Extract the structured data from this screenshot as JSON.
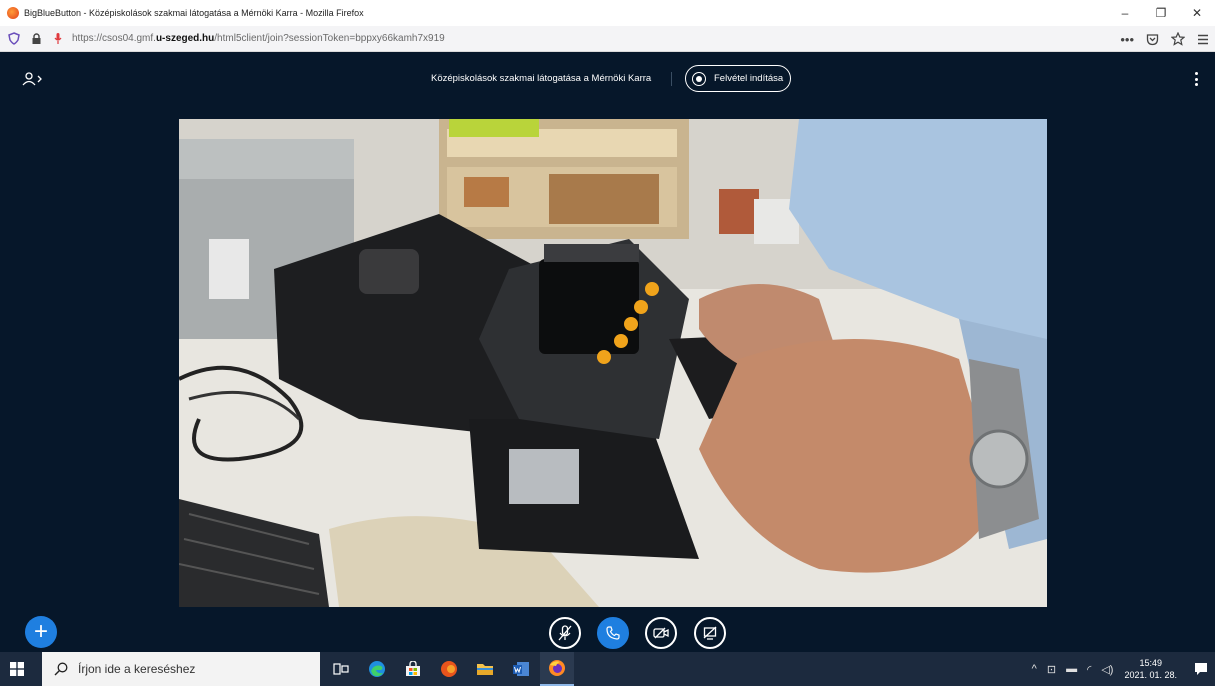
{
  "window": {
    "title": "BigBlueButton - Középiskolások szakmai látogatása a Mérnöki Karra - Mozilla Firefox",
    "controls": [
      "–",
      "❐",
      "✕"
    ]
  },
  "browser": {
    "url_prefix": "https://csos04.gmf.",
    "url_domain": "u-szeged.hu",
    "url_path": "/html5client/join?sessionToken=bppxy66kamh7x919",
    "more_label": "•••"
  },
  "meeting": {
    "title": "Középiskolások szakmai látogatása a Mérnöki Karra",
    "record_label": "Felvétel indítása"
  },
  "taskbar": {
    "search_placeholder": "Írjon ide a kereséshez",
    "time": "15:49",
    "date": "2021. 01. 28."
  },
  "colors": {
    "app_bg": "#06172a",
    "accent": "#1f7fe0",
    "taskbar_bg": "#1c2a3e"
  },
  "icons": {
    "users": "users-icon",
    "mic": "mic-muted-icon",
    "phone": "phone-icon",
    "camera": "camera-off-icon",
    "screenshare": "screenshare-off-icon"
  }
}
